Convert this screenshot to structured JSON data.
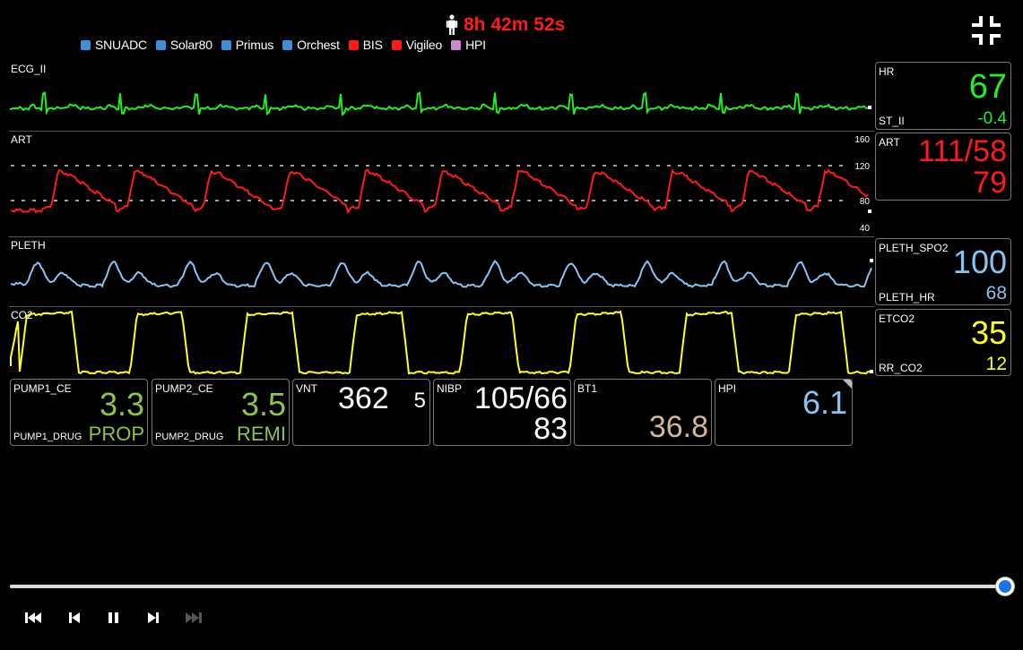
{
  "header": {
    "elapsed": "8h 42m 52s",
    "icon": "person-icon",
    "collapse_icon": "collapse-icon"
  },
  "legend": [
    {
      "label": "SNUADC",
      "color": "#3d8fd6"
    },
    {
      "label": "Solar80",
      "color": "#3d8fd6"
    },
    {
      "label": "Primus",
      "color": "#3d8fd6"
    },
    {
      "label": "Orchest",
      "color": "#3d8fd6"
    },
    {
      "label": "BIS",
      "color": "#ff1a1a"
    },
    {
      "label": "Vigileo",
      "color": "#ff1a1a"
    },
    {
      "label": "HPI",
      "color": "#cc88cc"
    }
  ],
  "tracks": {
    "ecg": {
      "label": "ECG_II",
      "color": "#22ee22"
    },
    "art": {
      "label": "ART",
      "color": "#ff1a1a",
      "scale": [
        "160",
        "120",
        "80",
        "40"
      ]
    },
    "pleth": {
      "label": "PLETH",
      "color": "#88c4f2"
    },
    "co2": {
      "label": "CO2",
      "color": "#ffff22"
    }
  },
  "numerics": {
    "hr": {
      "label": "HR",
      "value": "67",
      "sub_label": "ST_II",
      "sub_value": "-0.4",
      "color": "#22ee22"
    },
    "art": {
      "label": "ART",
      "value": "111/58",
      "mean": "79",
      "color": "#ff1a1a"
    },
    "pleth": {
      "label": "PLETH_SPO2",
      "value": "100",
      "sub_label": "PLETH_HR",
      "sub_value": "68",
      "color": "#88c4f2"
    },
    "etco2": {
      "label": "ETCO2",
      "value": "35",
      "sub_label": "RR_CO2",
      "sub_value": "12",
      "color": "#ffff22"
    }
  },
  "panels": {
    "pump1": {
      "label": "PUMP1_CE",
      "value": "3.3",
      "drug_label": "PUMP1_DRUG",
      "drug": "PROP",
      "color": "#8fc24a"
    },
    "pump2": {
      "label": "PUMP2_CE",
      "value": "3.5",
      "drug_label": "PUMP2_DRUG",
      "drug": "REMI",
      "color": "#8fc24a"
    },
    "vnt": {
      "label": "VNT",
      "value": "362",
      "extra": "5",
      "color": "#ffffff"
    },
    "nibp": {
      "label": "NIBP",
      "value": "105/66",
      "mean": "83",
      "color": "#ffffff"
    },
    "bt1": {
      "label": "BT1",
      "value": "36.8",
      "color": "#d2b79a"
    },
    "hpi": {
      "label": "HPI",
      "value": "6.1",
      "color": "#88c4f2"
    }
  },
  "playback": {
    "progress": 1.0,
    "controls": [
      "skip-back-icon",
      "step-back-icon",
      "pause-icon",
      "step-forward-icon",
      "skip-forward-icon"
    ]
  }
}
